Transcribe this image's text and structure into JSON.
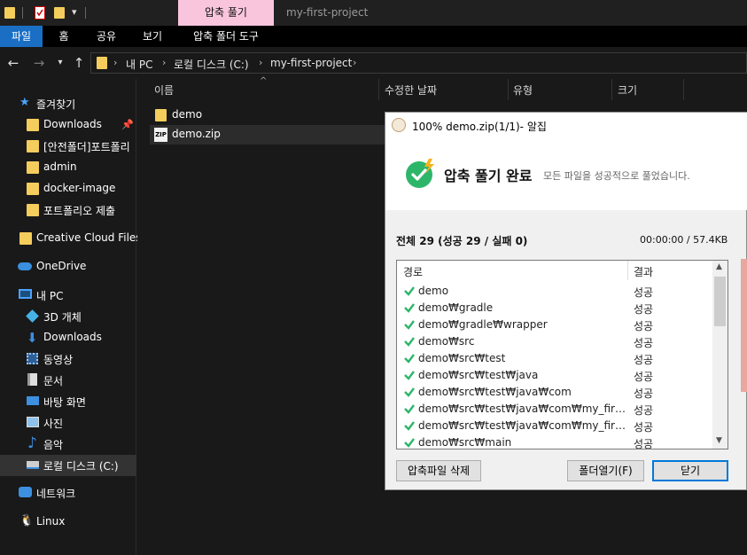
{
  "titlebar": {
    "context_tab": "압축 풀기",
    "window_title": "my-first-project"
  },
  "ribbon": {
    "tabs": [
      "파일",
      "홈",
      "공유",
      "보기",
      "압축 폴더 도구"
    ]
  },
  "address": {
    "crumbs": [
      "내 PC",
      "로컬 디스크 (C:)",
      "my-first-project"
    ]
  },
  "sidebar": {
    "quick_access": "즐겨찾기",
    "items": [
      "Downloads",
      "[안전폴더]포트폴리",
      "admin",
      "docker-image",
      "포트폴리오 제출"
    ],
    "creative_cloud": "Creative Cloud Files",
    "onedrive": "OneDrive",
    "this_pc": "내 PC",
    "pc_items": [
      "3D 개체",
      "Downloads",
      "동영상",
      "문서",
      "바탕 화면",
      "사진",
      "음악",
      "로컬 디스크 (C:)"
    ],
    "network": "네트워크",
    "linux": "Linux"
  },
  "content": {
    "columns": [
      "이름",
      "수정한 날짜",
      "유형",
      "크기"
    ],
    "files": [
      "demo",
      "demo.zip"
    ]
  },
  "dialog": {
    "title": "100% demo.zip(1/1)- 알집",
    "headline": "압축 풀기 완료",
    "subtext": "모든 파일을 성공적으로 풀었습니다.",
    "summary": "전체 29 (성공 29 / 실패 0)",
    "time_size": "00:00:00 / 57.4KB",
    "list_headers": [
      "경로",
      "결과"
    ],
    "rows": [
      {
        "path": "demo",
        "result": "성공"
      },
      {
        "path": "demo₩gradle",
        "result": "성공"
      },
      {
        "path": "demo₩gradle₩wrapper",
        "result": "성공"
      },
      {
        "path": "demo₩src",
        "result": "성공"
      },
      {
        "path": "demo₩src₩test",
        "result": "성공"
      },
      {
        "path": "demo₩src₩test₩java",
        "result": "성공"
      },
      {
        "path": "demo₩src₩test₩java₩com",
        "result": "성공"
      },
      {
        "path": "demo₩src₩test₩java₩com₩my_first_proj...",
        "result": "성공"
      },
      {
        "path": "demo₩src₩test₩java₩com₩my_first_proj...",
        "result": "성공"
      },
      {
        "path": "demo₩src₩main",
        "result": "성공"
      }
    ],
    "buttons": {
      "delete": "압축파일 삭제",
      "open_folder": "폴더열기(F)",
      "close": "닫기"
    }
  }
}
